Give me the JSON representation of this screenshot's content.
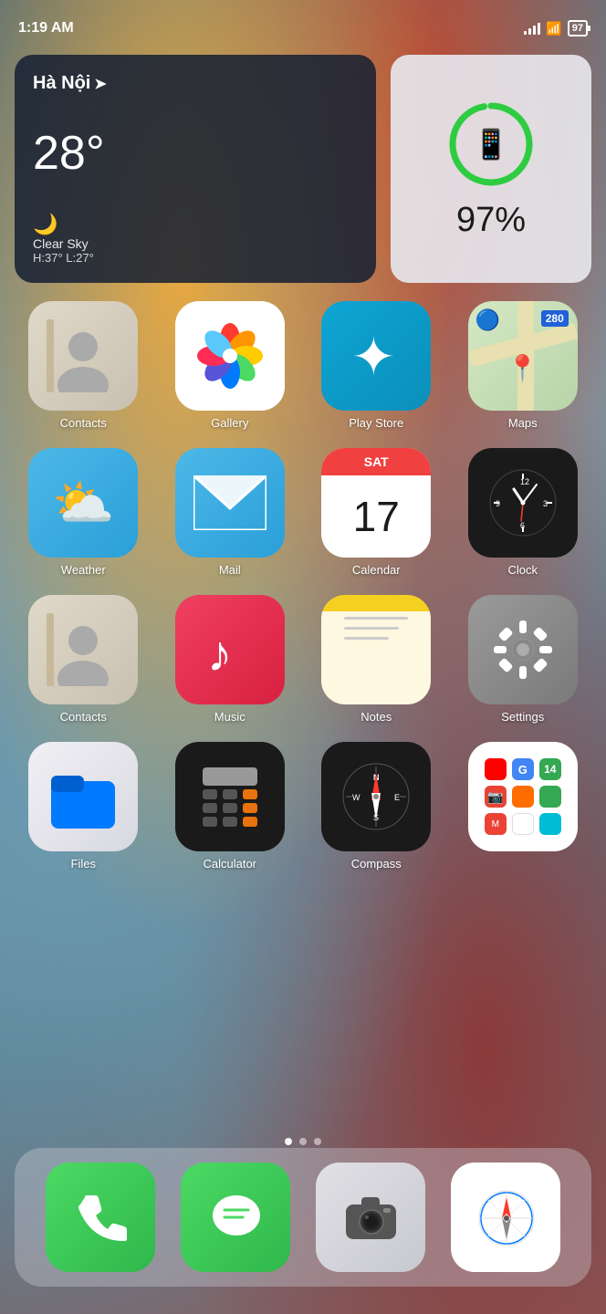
{
  "statusBar": {
    "time": "1:19 AM",
    "battery": "97"
  },
  "weatherWidget": {
    "city": "Hà Nội",
    "temp": "28°",
    "condition": "Clear Sky",
    "high": "H:37°",
    "low": "L:27°"
  },
  "batteryWidget": {
    "percent": "97%",
    "percentNum": 97
  },
  "apps": [
    {
      "id": "contacts",
      "label": "Contacts"
    },
    {
      "id": "gallery",
      "label": "Gallery"
    },
    {
      "id": "playstore",
      "label": "Play Store"
    },
    {
      "id": "maps",
      "label": "Maps"
    },
    {
      "id": "weather",
      "label": "Weather"
    },
    {
      "id": "mail",
      "label": "Mail"
    },
    {
      "id": "calendar",
      "label": "Calendar"
    },
    {
      "id": "clock",
      "label": "Clock"
    },
    {
      "id": "contacts2",
      "label": "Contacts"
    },
    {
      "id": "music",
      "label": "Music"
    },
    {
      "id": "notes",
      "label": "Notes"
    },
    {
      "id": "settings",
      "label": "Settings"
    },
    {
      "id": "files",
      "label": "Files"
    },
    {
      "id": "calculator",
      "label": "Calculator"
    },
    {
      "id": "compass",
      "label": "Compass"
    },
    {
      "id": "google",
      "label": ""
    }
  ],
  "dock": {
    "apps": [
      {
        "id": "phone",
        "label": "Phone"
      },
      {
        "id": "messages",
        "label": "Messages"
      },
      {
        "id": "camera",
        "label": "Camera"
      },
      {
        "id": "safari",
        "label": "Safari"
      }
    ]
  },
  "calendar": {
    "day": "SAT",
    "date": "17"
  },
  "pageDots": {
    "total": 3,
    "active": 0
  }
}
